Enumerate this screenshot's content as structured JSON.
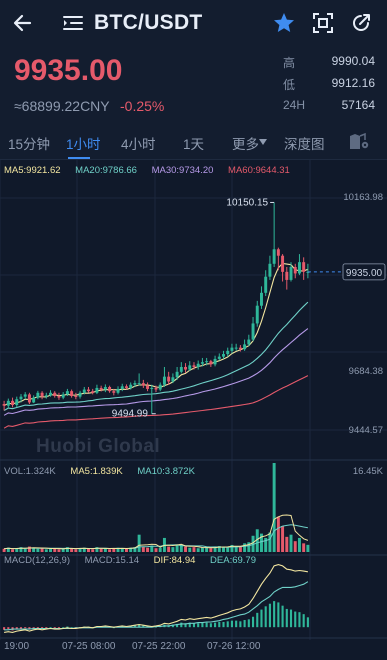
{
  "header": {
    "pair": "BTC/USDT"
  },
  "summary": {
    "price": "9935.00",
    "cny": "≈68899.22CNY",
    "change": "-0.25%",
    "stats": [
      {
        "key": "高",
        "value": "9990.04"
      },
      {
        "key": "低",
        "value": "9912.16"
      },
      {
        "key": "24H",
        "value": "57164"
      }
    ]
  },
  "tabs": [
    "15分钟",
    "1小时",
    "4小时",
    "1天",
    "更多",
    "深度图"
  ],
  "active_tab": 1,
  "colors": {
    "up": "#2fb79a",
    "down": "#e55a6b",
    "accent": "#3f8cf0",
    "ma5": "#f3e6a0",
    "ma20": "#6fd1c8",
    "ma30": "#b69ae8",
    "ma60": "#e55a6b",
    "dif": "#f3e6a0",
    "dea": "#6fd1c8"
  },
  "indicators": {
    "ma": [
      {
        "label": "MA5:9921.62",
        "color": "#f3e6a0"
      },
      {
        "label": "MA20:9786.66",
        "color": "#6fd1c8"
      },
      {
        "label": "MA30:9734.20",
        "color": "#b69ae8"
      },
      {
        "label": "MA60:9644.31",
        "color": "#e55a6b"
      }
    ],
    "vol": [
      {
        "label": "VOL:1.324K",
        "color": "#8f9bb0"
      },
      {
        "label": "MA5:1.839K",
        "color": "#f3e6a0"
      },
      {
        "label": "MA10:3.872K",
        "color": "#6fd1c8"
      }
    ],
    "macd": [
      {
        "label": "MACD(12,26,9)",
        "color": "#8f9bb0"
      },
      {
        "label": "MACD:15.14",
        "color": "#8f9bb0"
      },
      {
        "label": "DIF:84.94",
        "color": "#f3e6a0"
      },
      {
        "label": "DEA:69.79",
        "color": "#6fd1c8"
      }
    ]
  },
  "axis": {
    "price_ticks": [
      "10163.98",
      "9684.38",
      "9444.57"
    ],
    "current_price_tag": "9935.00",
    "high_marker": "10150.15",
    "low_marker": "9494.99",
    "volume_max": "16.45K",
    "time_labels": [
      "19:00",
      "07-25 08:00",
      "07-25 22:00",
      "07-26 12:00"
    ]
  },
  "watermark": "Huobi Global",
  "icons": {
    "back": "back-arrow-icon",
    "menu": "menu-list-icon",
    "star": "star-icon",
    "scan": "fullscreen-icon",
    "share": "share-icon",
    "settings": "chart-settings-icon"
  },
  "chart_data": {
    "type": "candlestick",
    "timeframe": "1小时",
    "ohlc_open": [
      9525,
      9520,
      9535,
      9522,
      9540,
      9548,
      9555,
      9530,
      9545,
      9560,
      9548,
      9552,
      9560,
      9550,
      9545,
      9555,
      9565,
      9550,
      9548,
      9560,
      9570,
      9565,
      9560,
      9575,
      9570,
      9578,
      9565,
      9560,
      9572,
      9580,
      9575,
      9585,
      9590,
      9590,
      9582,
      9572,
      9575,
      9570,
      9585,
      9610,
      9595,
      9608,
      9625,
      9640,
      9632,
      9645,
      9640,
      9650,
      9655,
      9658,
      9648,
      9665,
      9672,
      9680,
      9690,
      9700,
      9700,
      9695,
      9710,
      9725,
      9775,
      9830,
      9870,
      9920,
      9960,
      10005,
      9985,
      9935,
      9910,
      9950,
      9930,
      9965,
      9935
    ],
    "ohlc_close": [
      9520,
      9535,
      9522,
      9540,
      9548,
      9555,
      9530,
      9545,
      9560,
      9548,
      9552,
      9560,
      9550,
      9545,
      9555,
      9565,
      9550,
      9548,
      9560,
      9570,
      9565,
      9560,
      9575,
      9570,
      9578,
      9565,
      9560,
      9572,
      9580,
      9575,
      9585,
      9590,
      9590,
      9582,
      9572,
      9575,
      9570,
      9585,
      9610,
      9595,
      9608,
      9625,
      9640,
      9632,
      9645,
      9640,
      9650,
      9655,
      9658,
      9648,
      9665,
      9672,
      9680,
      9690,
      9700,
      9700,
      9695,
      9710,
      9725,
      9775,
      9830,
      9870,
      9920,
      9960,
      10005,
      9985,
      9935,
      9910,
      9950,
      9930,
      9965,
      9935,
      9935
    ],
    "ohlc_high": [
      9535,
      9542,
      9545,
      9548,
      9556,
      9562,
      9560,
      9552,
      9566,
      9565,
      9560,
      9568,
      9565,
      9560,
      9562,
      9572,
      9570,
      9560,
      9566,
      9578,
      9578,
      9572,
      9585,
      9582,
      9586,
      9582,
      9572,
      9580,
      9588,
      9586,
      9592,
      9598,
      9620,
      9600,
      9592,
      9585,
      9582,
      9592,
      9640,
      9625,
      9620,
      9640,
      9655,
      9652,
      9658,
      9655,
      9660,
      9668,
      9668,
      9662,
      9675,
      9682,
      9690,
      9700,
      9712,
      9712,
      9708,
      9725,
      9740,
      9795,
      9845,
      9890,
      9940,
      9985,
      10150.15,
      10010,
      9990,
      9950,
      9965,
      9960,
      9990,
      9980,
      9960
    ],
    "ohlc_low": [
      9505,
      9512,
      9515,
      9516,
      9530,
      9540,
      9525,
      9528,
      9540,
      9540,
      9542,
      9548,
      9545,
      9538,
      9540,
      9550,
      9545,
      9540,
      9542,
      9555,
      9560,
      9555,
      9556,
      9564,
      9562,
      9560,
      9552,
      9555,
      9565,
      9570,
      9570,
      9578,
      9582,
      9575,
      9565,
      9494.99,
      9562,
      9565,
      9578,
      9585,
      9590,
      9600,
      9620,
      9622,
      9628,
      9632,
      9632,
      9642,
      9645,
      9640,
      9642,
      9660,
      9665,
      9672,
      9682,
      9690,
      9688,
      9690,
      9705,
      9720,
      9765,
      9820,
      9860,
      9910,
      9950,
      9940,
      9905,
      9880,
      9905,
      9915,
      9925,
      9910,
      9915
    ],
    "ma_series": [
      {
        "name": "MA5",
        "last": 9921.62
      },
      {
        "name": "MA20",
        "last": 9786.66
      },
      {
        "name": "MA30",
        "last": 9734.2
      },
      {
        "name": "MA60",
        "last": 9644.31
      }
    ],
    "volume": [
      0.6,
      0.8,
      0.5,
      0.7,
      0.9,
      0.6,
      1.0,
      0.7,
      0.6,
      0.8,
      0.5,
      0.6,
      0.7,
      0.5,
      0.6,
      0.9,
      0.6,
      0.5,
      0.7,
      0.8,
      0.6,
      0.5,
      0.9,
      0.6,
      0.7,
      0.5,
      0.6,
      0.8,
      0.7,
      0.6,
      0.8,
      0.9,
      3.2,
      1.0,
      0.8,
      1.2,
      0.7,
      0.8,
      2.6,
      1.0,
      0.9,
      1.2,
      1.4,
      1.0,
      0.8,
      0.9,
      0.7,
      0.8,
      0.9,
      0.7,
      1.0,
      1.1,
      0.9,
      1.0,
      1.3,
      1.1,
      1.0,
      1.6,
      1.8,
      3.0,
      4.2,
      3.4,
      2.6,
      3.6,
      16.45,
      6.5,
      4.8,
      2.8,
      3.2,
      2.0,
      2.6,
      1.6,
      1.324
    ],
    "macd_hist": [
      -4,
      -3,
      -5,
      -3,
      -2,
      -1,
      -3,
      -2,
      -1,
      -2,
      -1,
      0,
      -1,
      -1,
      0,
      1,
      0,
      -1,
      0,
      1,
      1,
      0,
      1,
      1,
      2,
      1,
      0,
      1,
      2,
      1,
      2,
      3,
      4,
      3,
      2,
      1,
      1,
      2,
      4,
      3,
      4,
      5,
      7,
      6,
      7,
      6,
      6,
      7,
      7,
      6,
      7,
      8,
      8,
      9,
      10,
      10,
      9,
      11,
      12,
      16,
      22,
      27,
      32,
      36,
      40,
      38,
      33,
      28,
      27,
      24,
      23,
      20,
      15.14
    ],
    "dif": [
      -8,
      -7,
      -8,
      -6,
      -5,
      -4,
      -6,
      -4,
      -3,
      -4,
      -3,
      -2,
      -3,
      -3,
      -2,
      -1,
      -2,
      -2,
      -1,
      0,
      0,
      -1,
      1,
      1,
      2,
      1,
      0,
      1,
      2,
      1,
      2,
      3,
      4,
      3,
      2,
      1,
      2,
      3,
      6,
      5,
      7,
      9,
      12,
      11,
      13,
      12,
      13,
      14,
      15,
      14,
      16,
      18,
      20,
      22,
      25,
      27,
      28,
      31,
      35,
      44,
      55,
      66,
      75,
      83,
      94,
      96,
      94,
      89,
      88,
      86,
      87,
      86,
      84.94
    ],
    "dea": [
      -4,
      -4,
      -3,
      -3,
      -3,
      -3,
      -3,
      -2,
      -2,
      -2,
      -2,
      -2,
      -2,
      -2,
      -2,
      -2,
      -2,
      -1,
      -1,
      -1,
      -1,
      -1,
      0,
      0,
      0,
      0,
      0,
      0,
      0,
      0,
      0,
      0,
      0,
      0,
      0,
      0,
      1,
      1,
      2,
      2,
      3,
      4,
      5,
      5,
      6,
      6,
      7,
      7,
      8,
      8,
      9,
      10,
      12,
      13,
      15,
      17,
      19,
      20,
      23,
      28,
      33,
      39,
      43,
      47,
      54,
      58,
      61,
      61,
      61,
      62,
      64,
      66,
      69.79
    ],
    "price_range": [
      9444.57,
      10163.98
    ],
    "volume_range": [
      0,
      16.45
    ]
  }
}
